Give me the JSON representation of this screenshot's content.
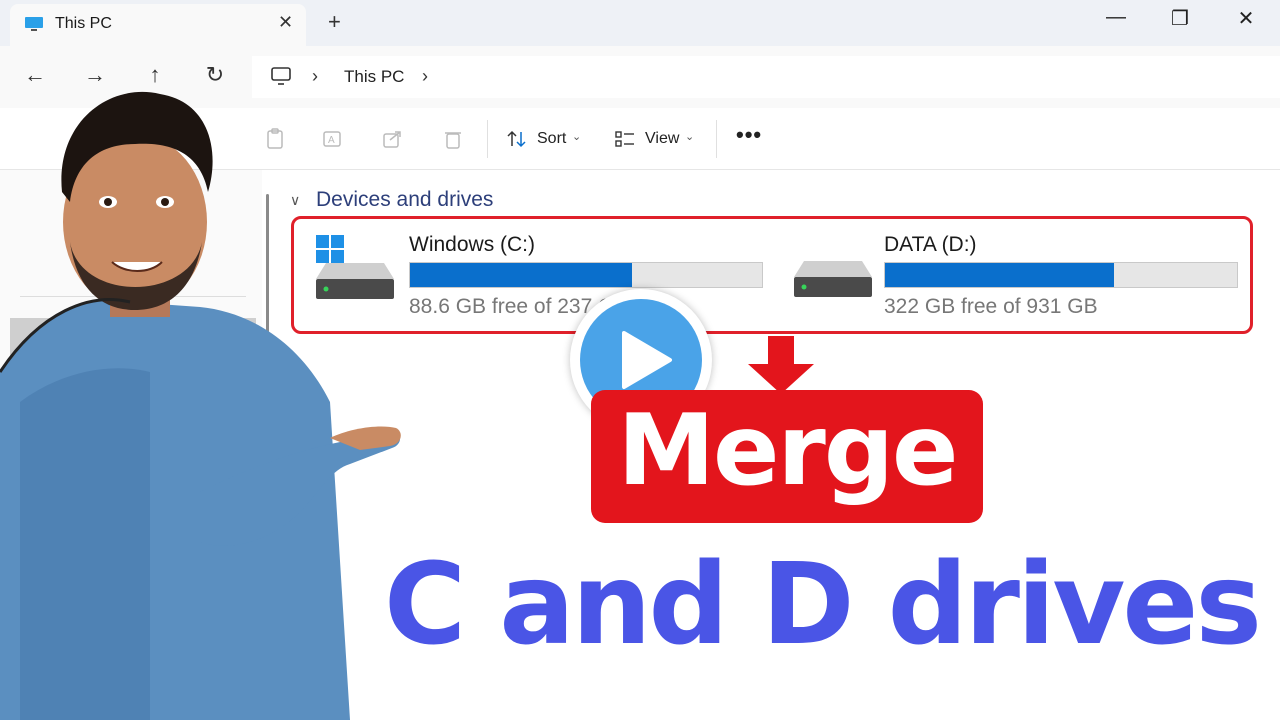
{
  "window": {
    "tab_title": "This PC",
    "close_tab": "✕",
    "new_tab": "+",
    "minimize": "—",
    "maximize": "❐",
    "close": "✕"
  },
  "nav": {
    "back": "←",
    "forward": "→",
    "up": "↑",
    "refresh": "↻",
    "breadcrumb": [
      "This PC"
    ]
  },
  "toolbar": {
    "sort_label": "Sort",
    "view_label": "View",
    "more_label": "•••"
  },
  "content": {
    "section_title": "Devices and drives",
    "drives": [
      {
        "name": "Windows (C:)",
        "free_text": "88.6 GB free of 237 GB",
        "used_fraction": 0.63
      },
      {
        "name": "DATA (D:)",
        "free_text": "322 GB free of 931 GB",
        "used_fraction": 0.65
      }
    ]
  },
  "overlay": {
    "merge_label": "Merge",
    "headline": "C and D drives"
  },
  "colors": {
    "accent_blue": "#0a6fcc",
    "highlight_red": "#e3151c",
    "headline_blue": "#4a55e6",
    "play_blue": "#4aa3e8"
  }
}
